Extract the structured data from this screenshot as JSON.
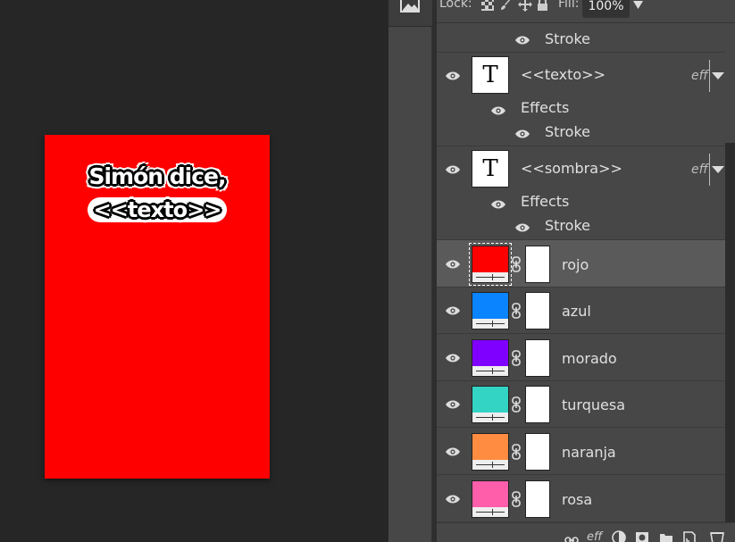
{
  "canvas": {
    "line1": "Simón dice,",
    "line2": "<<texto>>",
    "background": "#ff0000"
  },
  "toolbar": {
    "lock_label": "Lock:",
    "fill_label": "Fill:",
    "fill_value": "100%"
  },
  "layers": {
    "top_stroke": "Stroke",
    "texto": {
      "name": "<<texto>>",
      "effects": "Effects",
      "stroke": "Stroke",
      "eff": "eff"
    },
    "sombra": {
      "name": "<<sombra>>",
      "effects": "Effects",
      "stroke": "Stroke",
      "eff": "eff"
    },
    "color_layers": [
      {
        "name": "rojo",
        "color": "#ff0000"
      },
      {
        "name": "azul",
        "color": "#0a84ff"
      },
      {
        "name": "morado",
        "color": "#8000ff"
      },
      {
        "name": "turquesa",
        "color": "#33d4c4"
      },
      {
        "name": "naranja",
        "color": "#ff8c40"
      },
      {
        "name": "rosa",
        "color": "#ff5eaa"
      }
    ]
  },
  "bottom": {
    "eff_label": "eff"
  }
}
